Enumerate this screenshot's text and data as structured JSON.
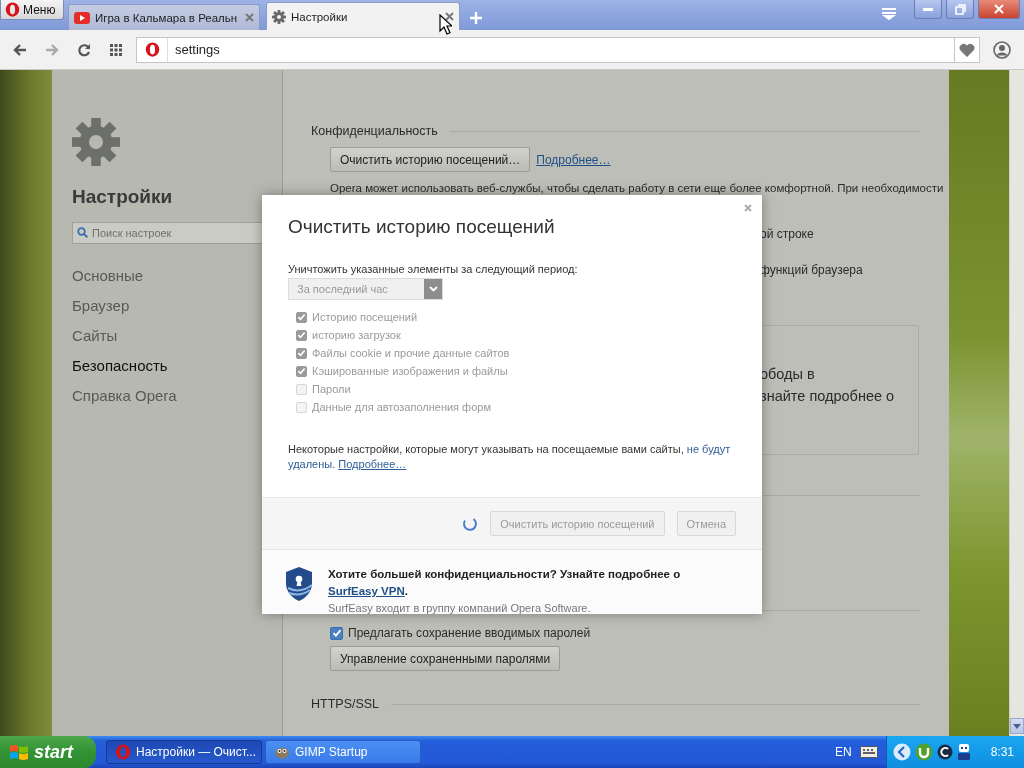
{
  "browser": {
    "menu_button": "Меню",
    "tabs": [
      {
        "title": "Игра в Кальмара в Реальн",
        "selected": false
      },
      {
        "title": "Настройки",
        "selected": true
      }
    ],
    "address": "settings"
  },
  "sidebar": {
    "title": "Настройки",
    "search_placeholder": "Поиск настроек",
    "items": [
      {
        "label": "Основные",
        "selected": false
      },
      {
        "label": "Браузер",
        "selected": false
      },
      {
        "label": "Сайты",
        "selected": false
      },
      {
        "label": "Безопасность",
        "selected": true
      },
      {
        "label": "Справка Opera",
        "selected": false
      }
    ]
  },
  "content": {
    "section_title": "Конфиденциальность",
    "clear_button": "Очистить историю посещений…",
    "more_link": "Подробнее…",
    "web_services_text": "Opera может использовать веб-службы, чтобы сделать работу в сети еще более комфортной. При необходимости",
    "partial_lines": [
      "ой строке",
      "функций браузера"
    ],
    "box_lines": [
      "ободы в",
      "знайте подробнее о"
    ],
    "password_checkbox": {
      "label": "Предлагать сохранение вводимых паролей",
      "checked": true
    },
    "manage_passwords_button": "Управление сохраненными паролями",
    "https_title": "HTTPS/SSL"
  },
  "dialog": {
    "title": "Очистить историю посещений",
    "period_label": "Уничтожить указанные элементы за следующий период:",
    "period": {
      "value": "За последний час",
      "disabled": true
    },
    "items": [
      {
        "label": "Историю посещений",
        "checked": true,
        "disabled": true
      },
      {
        "label": "историю загрузок",
        "checked": true,
        "disabled": true
      },
      {
        "label": "Файлы cookie и прочие данные сайтов",
        "checked": true,
        "disabled": true
      },
      {
        "label": "Кэшированные изображения и файлы",
        "checked": true,
        "disabled": true
      },
      {
        "label": "Пароли",
        "checked": false,
        "disabled": true
      },
      {
        "label": "Данные для автозаполнения форм",
        "checked": false,
        "disabled": true
      }
    ],
    "note": "Некоторые настройки, которые могут указывать на посещаемые вами сайты, ",
    "note_emphasis": "не будут удалены.",
    "note_link": "Подробнее…",
    "buttons": [
      {
        "label": "Очистить историю посещений",
        "disabled": true
      },
      {
        "label": "Отмена",
        "disabled": true
      }
    ],
    "promo_title": "Хотите большей конфиденциальности? Узнайте подробнее о ",
    "promo_link": "SurfEasy VPN",
    "promo_end": ".",
    "promo_text": "SurfEasy входит в группу компаний Opera Software."
  },
  "taskbar": {
    "start": "start",
    "tasks": [
      {
        "label": "Настройки — Очист...",
        "selected": true
      },
      {
        "label": "GIMP Startup",
        "selected": false
      }
    ],
    "language": "EN",
    "clock": "8:31"
  }
}
